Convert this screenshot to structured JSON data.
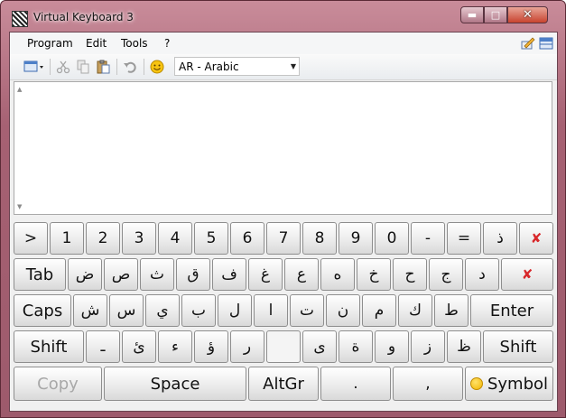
{
  "window": {
    "title": "Virtual Keyboard 3"
  },
  "menu": {
    "items": [
      "Program",
      "Edit",
      "Tools",
      "?"
    ]
  },
  "toolbar": {
    "language": "AR - Arabic"
  },
  "keyboard": {
    "row1": [
      ">",
      "1",
      "2",
      "3",
      "4",
      "5",
      "6",
      "7",
      "8",
      "9",
      "0",
      "-",
      "=",
      "ذ"
    ],
    "row2": {
      "tab": "Tab",
      "keys": [
        "ض",
        "ص",
        "ث",
        "ق",
        "ف",
        "غ",
        "ع",
        "ه",
        "خ",
        "ح",
        "ج",
        "د"
      ]
    },
    "row3": {
      "caps": "Caps",
      "keys": [
        "ش",
        "س",
        "ي",
        "ب",
        "ل",
        "ا",
        "ت",
        "ن",
        "م",
        "ك",
        "ط"
      ],
      "enter": "Enter"
    },
    "row4": {
      "shift_left": "Shift",
      "keys": [
        "ـ",
        "ئ",
        "ء",
        "ؤ",
        "ر",
        "",
        "ى",
        "ة",
        "و",
        "ز",
        "ظ"
      ],
      "shift_right": "Shift"
    },
    "row5": {
      "copy": "Copy",
      "space": "Space",
      "altgr": "AltGr",
      "dot": ".",
      "comma": ",",
      "symbol": "Symbol"
    }
  }
}
